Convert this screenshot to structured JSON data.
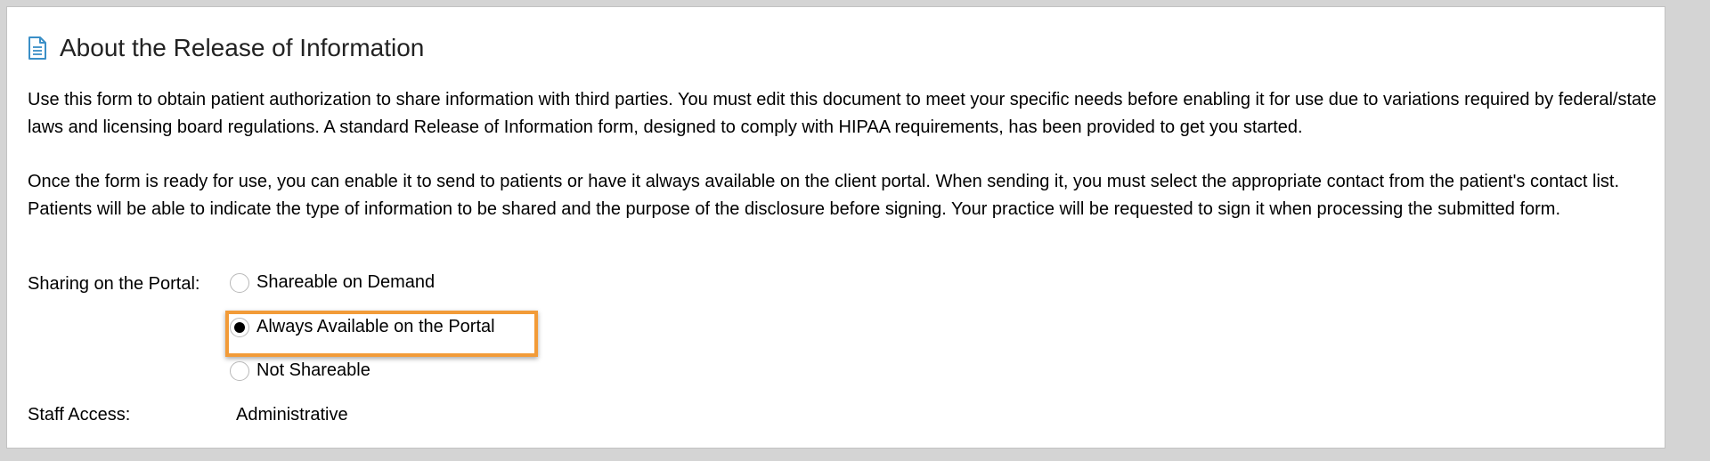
{
  "header": {
    "title": "About the Release of Information",
    "icon": "document-icon",
    "icon_color": "#3a8fc7"
  },
  "description": {
    "paragraph1": "Use this form to obtain patient authorization to share information with third parties. You must edit this document to meet your specific needs before enabling it for use due to variations required by federal/state laws and licensing board regulations. A standard Release of Information form, designed to comply with HIPAA requirements, has been provided to get you started.",
    "paragraph2": "Once the form is ready for use, you can enable it to send to patients or have it always available on the client portal. When sending it, you must select the appropriate contact from the patient's contact list. Patients will be able to indicate the type of information to be shared and the purpose of the disclosure before signing. Your practice will be requested to sign it when processing the submitted form."
  },
  "sharing": {
    "label": "Sharing on the Portal:",
    "options": [
      {
        "label": "Shareable on Demand",
        "selected": false
      },
      {
        "label": "Always Available on the Portal",
        "selected": true
      },
      {
        "label": "Not Shareable",
        "selected": false
      }
    ],
    "highlight_color": "#f29b38"
  },
  "staff_access": {
    "label": "Staff Access:",
    "value": "Administrative"
  }
}
